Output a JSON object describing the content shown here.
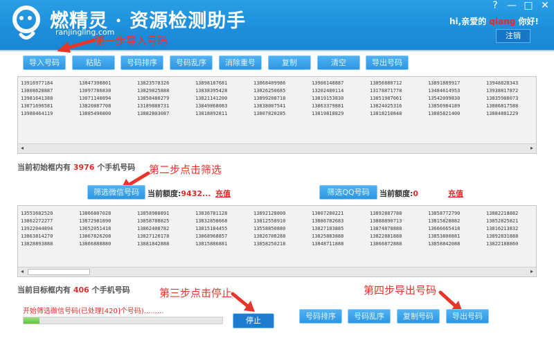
{
  "header": {
    "brand": "燃精灵 · 资源检测助手",
    "url": "ranjingling.com",
    "greeting_prefix": "hi,亲爱的",
    "username": "qiang",
    "greeting_suffix": "你好!",
    "logout_label": "注销",
    "window_buttons": [
      "?",
      "—",
      "□",
      "✕"
    ]
  },
  "annotations": {
    "step1": "第一步导入号码",
    "step2": "第二步点击筛选",
    "step3": "第三步点击停止",
    "step4": "第四步导出号码"
  },
  "toolbar": {
    "buttons": [
      "导入号码",
      "粘贴",
      "号码排序",
      "号码乱序",
      "消除重号",
      "复制",
      "清空",
      "导出号码"
    ]
  },
  "source_box": {
    "rows": [
      [
        "13916977184",
        "13847398801",
        "13823578326",
        "13898187681",
        "13868409986",
        "13908148887",
        "13856880712",
        "13891889917",
        "13948828343"
      ],
      [
        "13808628887",
        "13097786830",
        "13829825888",
        "13838395428",
        "13826250685",
        "13202480114",
        "13178871778",
        "13484614953",
        "13938817872"
      ],
      [
        "13981641388",
        "13071140894",
        "13858480279",
        "13821141200",
        "13899208718",
        "13819153830",
        "13851987061",
        "13542099830",
        "13835988073"
      ],
      [
        "13671696581",
        "13820887708",
        "13189888731",
        "13849868083",
        "13838007541",
        "13863379881",
        "13824025316",
        "13856984189",
        "13886817588"
      ],
      [
        "13988464119",
        "13885490800",
        "13882803087",
        "13818892811",
        "13807820285",
        "13819818829",
        "13818210848",
        "13885821400",
        "13884881229"
      ]
    ]
  },
  "initial_status": {
    "prefix": "当前初始框内有",
    "count": "3976",
    "suffix": "个手机号码"
  },
  "wechat": {
    "filter_label": "筛选微信号码",
    "quota_label": "当前额度:",
    "quota_value": "9432...",
    "recharge": "充值"
  },
  "qq": {
    "filter_label": "筛选QQ号码",
    "quota_label": "当前额度:",
    "quota_value": "0",
    "recharge": "充值"
  },
  "target_box": {
    "rows": [
      [
        "13553682520",
        "13866807028",
        "13858980891",
        "13836781128",
        "13892128800",
        "13807280221",
        "13892887788",
        "13858772790",
        "13882218882"
      ],
      [
        "13862272277",
        "13872981890",
        "13858788825",
        "13832858668",
        "13812558910",
        "13886782683",
        "13888890713",
        "13815828882",
        "13852825821"
      ],
      [
        "13922044894",
        "13652051418",
        "13862408782",
        "13815184455",
        "13558850880",
        "13827183885",
        "13874878888",
        "13666665418",
        "13816213832"
      ],
      [
        "13863814270",
        "13867826208",
        "13827120178",
        "13868968857",
        "13826708288",
        "13825883888",
        "13822881888",
        "13853800881",
        "13892831888"
      ],
      [
        "13828893888",
        "13866888880",
        "13881842888",
        "13815886881",
        "13858250218",
        "13848711888",
        "13866872888",
        "13858842088",
        "13822188860"
      ]
    ]
  },
  "target_status": {
    "prefix": "当前目标框内有",
    "count": "406",
    "suffix": "个手机号码"
  },
  "progress": {
    "text": "开始筛选微信号码(已处理[420]个号码).........",
    "fraction": 0.08
  },
  "stop_label": "停止",
  "bottom_buttons": [
    "号码排序",
    "号码乱序",
    "复制号码",
    "导出号码"
  ],
  "colors": {
    "header": "#1e8fdc",
    "annotation": "#e8352a",
    "count": "#e62a2a"
  }
}
